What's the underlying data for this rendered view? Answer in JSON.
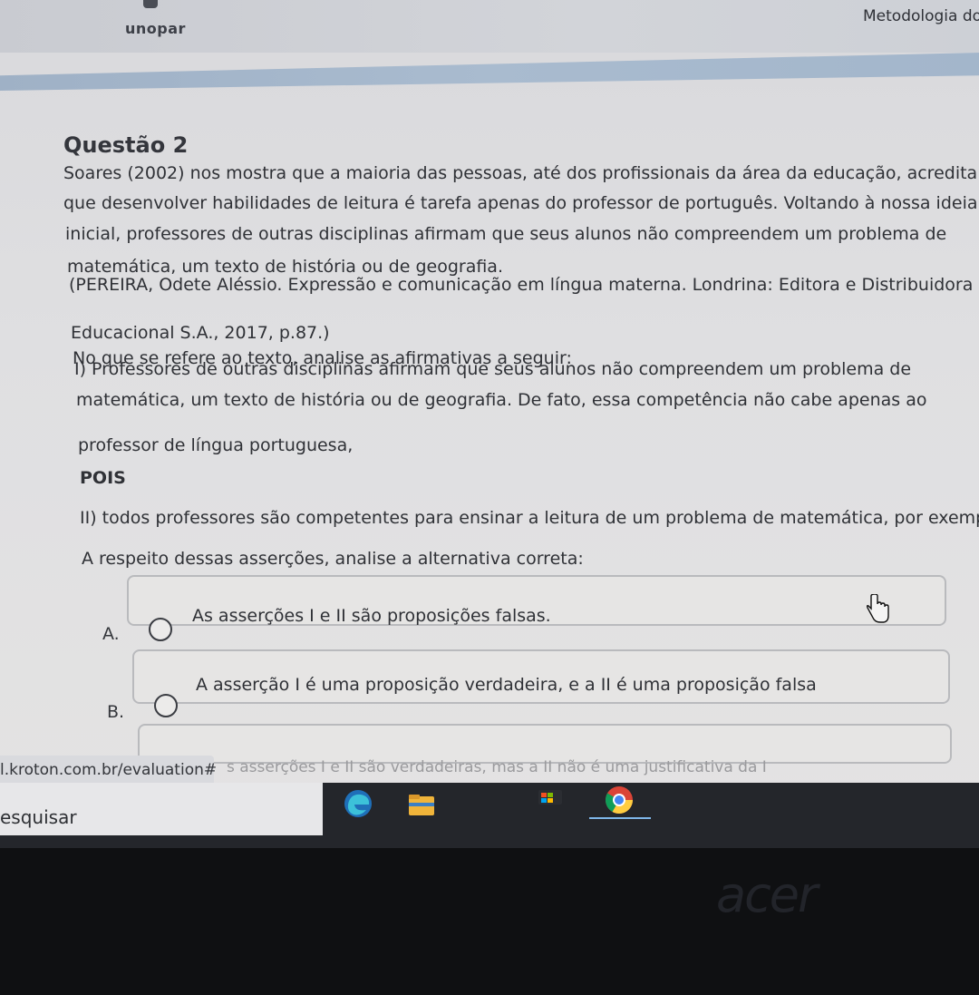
{
  "header": {
    "logo": "unopar",
    "course_title": "Metodologia do"
  },
  "question": {
    "title": "Questão 2",
    "lines": [
      "Soares (2002) nos mostra que a maioria das pessoas, até dos profissionais da área da educação, acredita",
      "que desenvolver habilidades de leitura é tarefa apenas do professor de português. Voltando à nossa ideia",
      "inicial, professores de outras disciplinas afirmam que seus alunos não compreendem um problema de",
      "matemática, um texto de história ou de geografia.",
      "(PEREIRA, Odete Aléssio. Expressão e comunicação em língua materna. Londrina: Editora e Distribuidora",
      "Educacional S.A., 2017, p.87.)",
      "No que se refere ao texto, analise as afirmativas a seguir:",
      "I) Professores de outras disciplinas afirmam que seus alunos não compreendem um problema de",
      "matemática, um texto de história ou de geografia. De fato, essa competência não cabe apenas ao",
      "professor de língua portuguesa,",
      "POIS",
      "II) todos professores são competentes para ensinar a leitura de um problema de matemática, por exemplo.",
      "A respeito dessas asserções, analise a alternativa correta:"
    ]
  },
  "options": [
    {
      "letter": "A.",
      "text": "As asserções I e II são proposições falsas."
    },
    {
      "letter": "B.",
      "text": "A asserção I é uma proposição verdadeira, e a II é uma proposição falsa"
    }
  ],
  "partial_option_text": "s asserções I e II são verdadeiras, mas a II não é uma justificativa da I",
  "status_url": "l.kroton.com.br/evaluation#",
  "taskbar": {
    "search_text": "esquisar",
    "icons": [
      "edge-icon",
      "file-explorer-icon",
      "store-icon",
      "chrome-icon"
    ]
  },
  "bezel": {
    "brand": "acer"
  }
}
